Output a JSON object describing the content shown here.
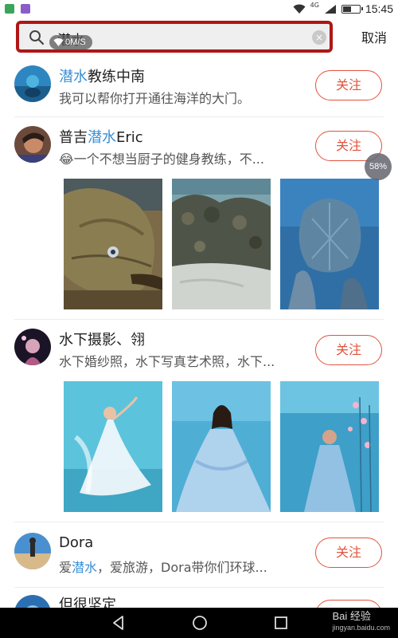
{
  "status_bar": {
    "network": "4G",
    "time": "15:45",
    "battery_level": 0.55
  },
  "search": {
    "query": "潜水",
    "speed_badge": "0M/S",
    "cancel_label": "取消",
    "clear_icon": "close-icon"
  },
  "download_progress": "58%",
  "users": [
    {
      "name_highlight": "潜水",
      "name_rest": "教练中南",
      "description": "我可以帮你打开通往海洋的大门。",
      "follow_label": "关注"
    },
    {
      "name_prefix": "普吉",
      "name_highlight": "潜水",
      "name_rest": "Eric",
      "description": "😂一个不想当厨子的健身教练，不...",
      "follow_label": "关注"
    },
    {
      "name": "水下摄影、翎",
      "description": "水下婚纱照，水下写真艺术照，水下...",
      "follow_label": "关注"
    },
    {
      "name": "Dora",
      "desc_prefix": "爱",
      "desc_highlight": "潜水",
      "desc_rest": "，爱旅游，Dora带你们环球...",
      "follow_label": "关注"
    },
    {
      "name": "但很坚定"
    }
  ],
  "watermark": {
    "brand": "Bai 经验",
    "site": "jingyan.baidu.com"
  },
  "colors": {
    "accent": "#e2533b",
    "highlight": "#3a8fd6",
    "search_border": "#b01616"
  }
}
